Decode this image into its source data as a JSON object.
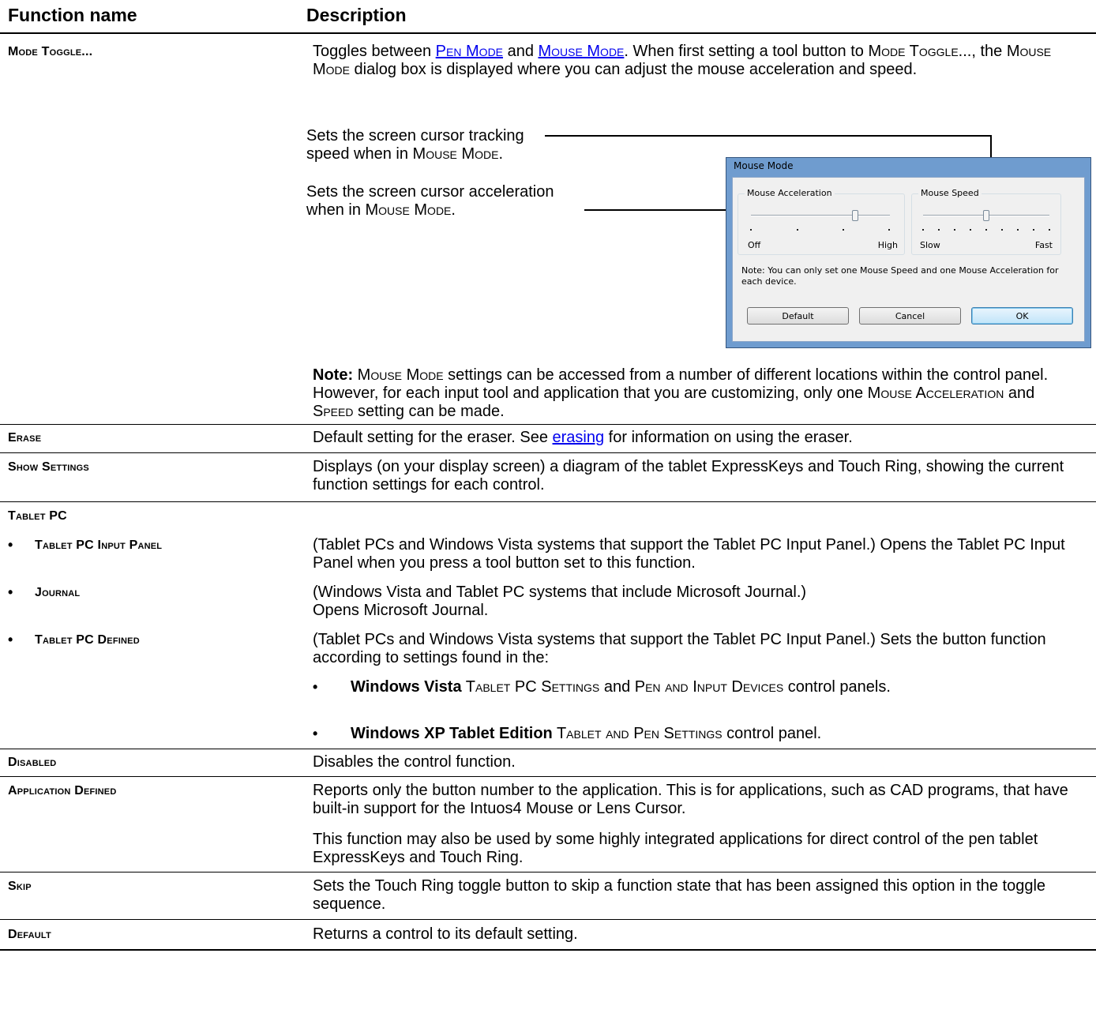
{
  "header": {
    "col1": "Function name",
    "col2": "Description"
  },
  "mode_toggle": {
    "name": "Mode Toggle...",
    "d1": "Toggles between ",
    "link_pen": "Pen Mode",
    "d2": " and ",
    "link_mouse": "Mouse Mode",
    "d3": ".  When first setting a tool button to ",
    "sc1": "Mode Toggle...",
    "d4": ", the ",
    "sc2": "Mouse Mode",
    "d5": " dialog box is displayed where you can adjust the mouse acceleration and speed.",
    "ann_speed_1": "Sets the screen cursor tracking",
    "ann_speed_2": "speed when in ",
    "ann_speed_sc": "Mouse Mode",
    "ann_accel_1": "Sets the screen cursor acceleration",
    "ann_accel_2": "when in ",
    "ann_accel_sc": "Mouse Mode",
    "note_label": "Note:",
    "note_sc1": "Mouse Mode",
    "note_1": " settings can be accessed from a number of different locations within the control panel.  However, for each input tool and application that you are customizing, only one ",
    "note_sc2": "Mouse Acceleration",
    "note_2": " and ",
    "note_sc3": "Speed",
    "note_3": " setting can be made."
  },
  "dialog": {
    "title": "Mouse Mode",
    "accel_group": "Mouse Acceleration",
    "accel_min": "Off",
    "accel_max": "High",
    "accel_value": 0.75,
    "speed_group": "Mouse Speed",
    "speed_min": "Slow",
    "speed_max": "Fast",
    "speed_value": 0.5,
    "note": "Note: You can only set one Mouse Speed and one Mouse Acceleration for each device.",
    "btn_default": "Default",
    "btn_cancel": "Cancel",
    "btn_ok": "OK"
  },
  "erase": {
    "name": "Erase",
    "d1": "Default setting for the eraser.  See ",
    "link": "erasing",
    "d2": " for information on using the eraser."
  },
  "show_settings": {
    "name": "Show Settings",
    "desc": "Displays (on your display screen) a diagram of the tablet ExpressKeys and Touch Ring, showing the current function settings for each control."
  },
  "tablet_pc": {
    "name": "Tablet PC",
    "bullet": "•",
    "input_panel_name": "Tablet PC Input Panel",
    "input_panel_desc": "(Tablet PCs and Windows Vista systems that support the Tablet PC Input Panel.) Opens the Tablet PC Input Panel when you press a tool button set to this function.",
    "journal_name": "Journal",
    "journal_desc_1": "(Windows Vista and Tablet PC systems that include Microsoft Journal.)",
    "journal_desc_2": "Opens Microsoft Journal.",
    "defined_name": "Tablet PC Defined",
    "defined_desc": "(Tablet PCs and Windows Vista systems that support the Tablet PC Input Panel.) Sets the button function according to settings found in the:",
    "vista_bold": "Windows Vista",
    "vista_sc1": " Tablet PC Settings",
    "vista_and": " and ",
    "vista_sc2": "Pen and Input Devices",
    "vista_rest": " control panels.",
    "xp_bold": "Windows XP Tablet Edition",
    "xp_sc": " Tablet and Pen Settings",
    "xp_rest": " control panel."
  },
  "disabled": {
    "name": "Disabled",
    "desc": "Disables the control function."
  },
  "app_defined": {
    "name": "Application Defined",
    "desc1": "Reports only the button number to the application.  This is for applications, such as CAD programs, that have built-in support for the Intuos4 Mouse or Lens Cursor.",
    "desc2": "This function may also be used by some highly integrated applications for direct control of the pen tablet ExpressKeys and Touch Ring."
  },
  "skip": {
    "name": "Skip",
    "desc": "Sets the Touch Ring toggle button to skip a function state that has been assigned this option in the toggle sequence."
  },
  "default": {
    "name": "Default",
    "desc": "Returns a control to its default setting."
  }
}
